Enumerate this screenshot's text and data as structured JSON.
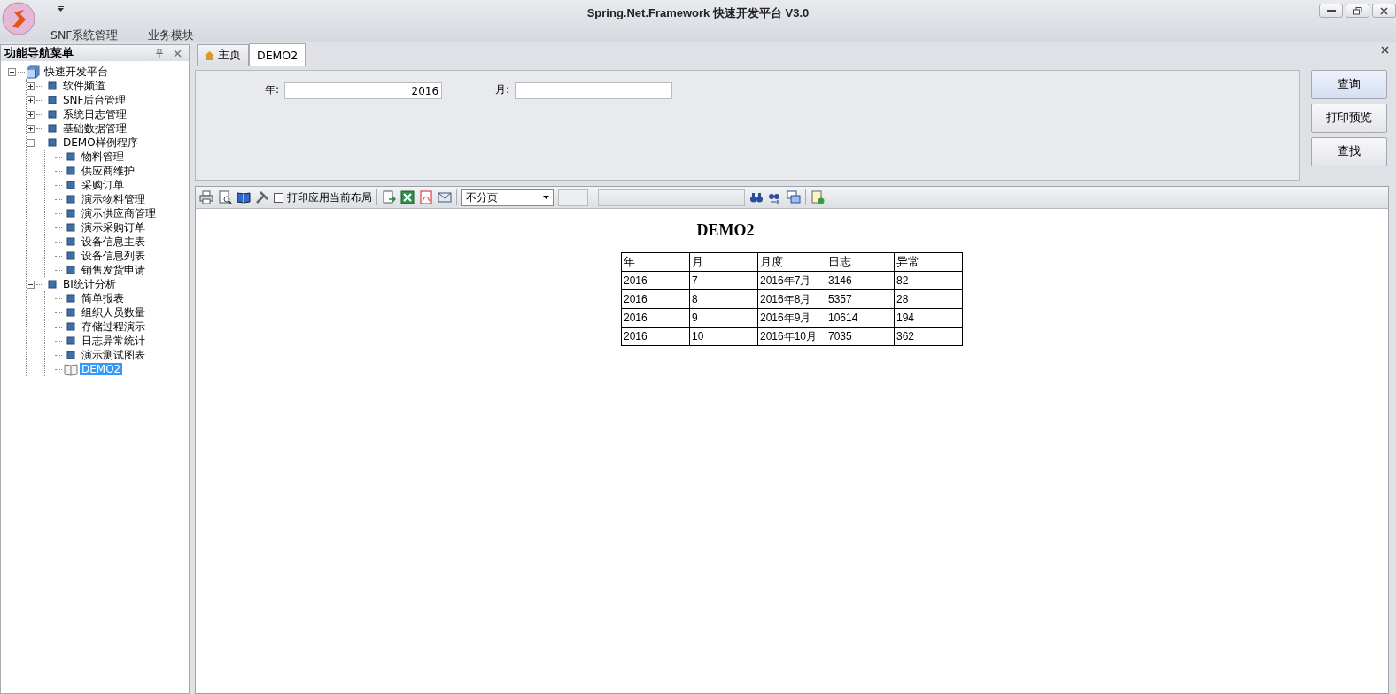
{
  "window": {
    "title": "Spring.Net.Framework 快速开发平台 V3.0",
    "menu": [
      "SNF系统管理",
      "业务模块"
    ]
  },
  "sidebar": {
    "title": "功能导航菜单",
    "tree": [
      {
        "label": "快速开发平台",
        "kind": "stack",
        "expanded": true,
        "selected": false,
        "children": [
          {
            "label": "软件频道",
            "kind": "square",
            "expanded": false,
            "selected": false
          },
          {
            "label": "SNF后台管理",
            "kind": "square",
            "expanded": false,
            "selected": false
          },
          {
            "label": "系统日志管理",
            "kind": "square",
            "expanded": false,
            "selected": false
          },
          {
            "label": "基础数据管理",
            "kind": "square",
            "expanded": false,
            "selected": false
          },
          {
            "label": "DEMO样例程序",
            "kind": "square",
            "expanded": true,
            "selected": false,
            "children": [
              {
                "label": "物料管理",
                "kind": "square",
                "selected": false
              },
              {
                "label": "供应商维护",
                "kind": "square",
                "selected": false
              },
              {
                "label": "采购订单",
                "kind": "square",
                "selected": false
              },
              {
                "label": "演示物料管理",
                "kind": "square",
                "selected": false
              },
              {
                "label": "演示供应商管理",
                "kind": "square",
                "selected": false
              },
              {
                "label": "演示采购订单",
                "kind": "square",
                "selected": false
              },
              {
                "label": "设备信息主表",
                "kind": "square",
                "selected": false
              },
              {
                "label": "设备信息列表",
                "kind": "square",
                "selected": false
              },
              {
                "label": "销售发货申请",
                "kind": "square",
                "selected": false
              }
            ]
          },
          {
            "label": "BI统计分析",
            "kind": "square",
            "expanded": true,
            "selected": false,
            "children": [
              {
                "label": "简单报表",
                "kind": "square",
                "selected": false
              },
              {
                "label": "组织人员数量",
                "kind": "square",
                "selected": false
              },
              {
                "label": "存储过程演示",
                "kind": "square",
                "selected": false
              },
              {
                "label": "日志异常统计",
                "kind": "square",
                "selected": false
              },
              {
                "label": "演示测试图表",
                "kind": "square",
                "selected": false
              },
              {
                "label": "DEMO2",
                "kind": "book",
                "selected": true
              }
            ]
          }
        ]
      }
    ]
  },
  "tabs": [
    {
      "label": "主页",
      "kind": "home",
      "selected": false
    },
    {
      "label": "DEMO2",
      "kind": "plain",
      "selected": true
    }
  ],
  "query": {
    "fields": [
      {
        "label": "年:",
        "value": "2016"
      },
      {
        "label": "月:"
      }
    ],
    "buttons": [
      "查询",
      "打印预览",
      "查找"
    ]
  },
  "report_toolbar": {
    "checkbox": {
      "label": "打印应用当前布局",
      "checked": false
    },
    "page_mode": "不分页"
  },
  "report": {
    "title": "DEMO2",
    "columns": [
      "年",
      "月",
      "月度",
      "日志",
      "异常"
    ],
    "rows": [
      [
        "2016",
        "7",
        "2016年7月",
        "3146",
        "82"
      ],
      [
        "2016",
        "8",
        "2016年8月",
        "5357",
        "28"
      ],
      [
        "2016",
        "9",
        "2016年9月",
        "10614",
        "194"
      ],
      [
        "2016",
        "10",
        "2016年10月",
        "7035",
        "362"
      ]
    ]
  }
}
